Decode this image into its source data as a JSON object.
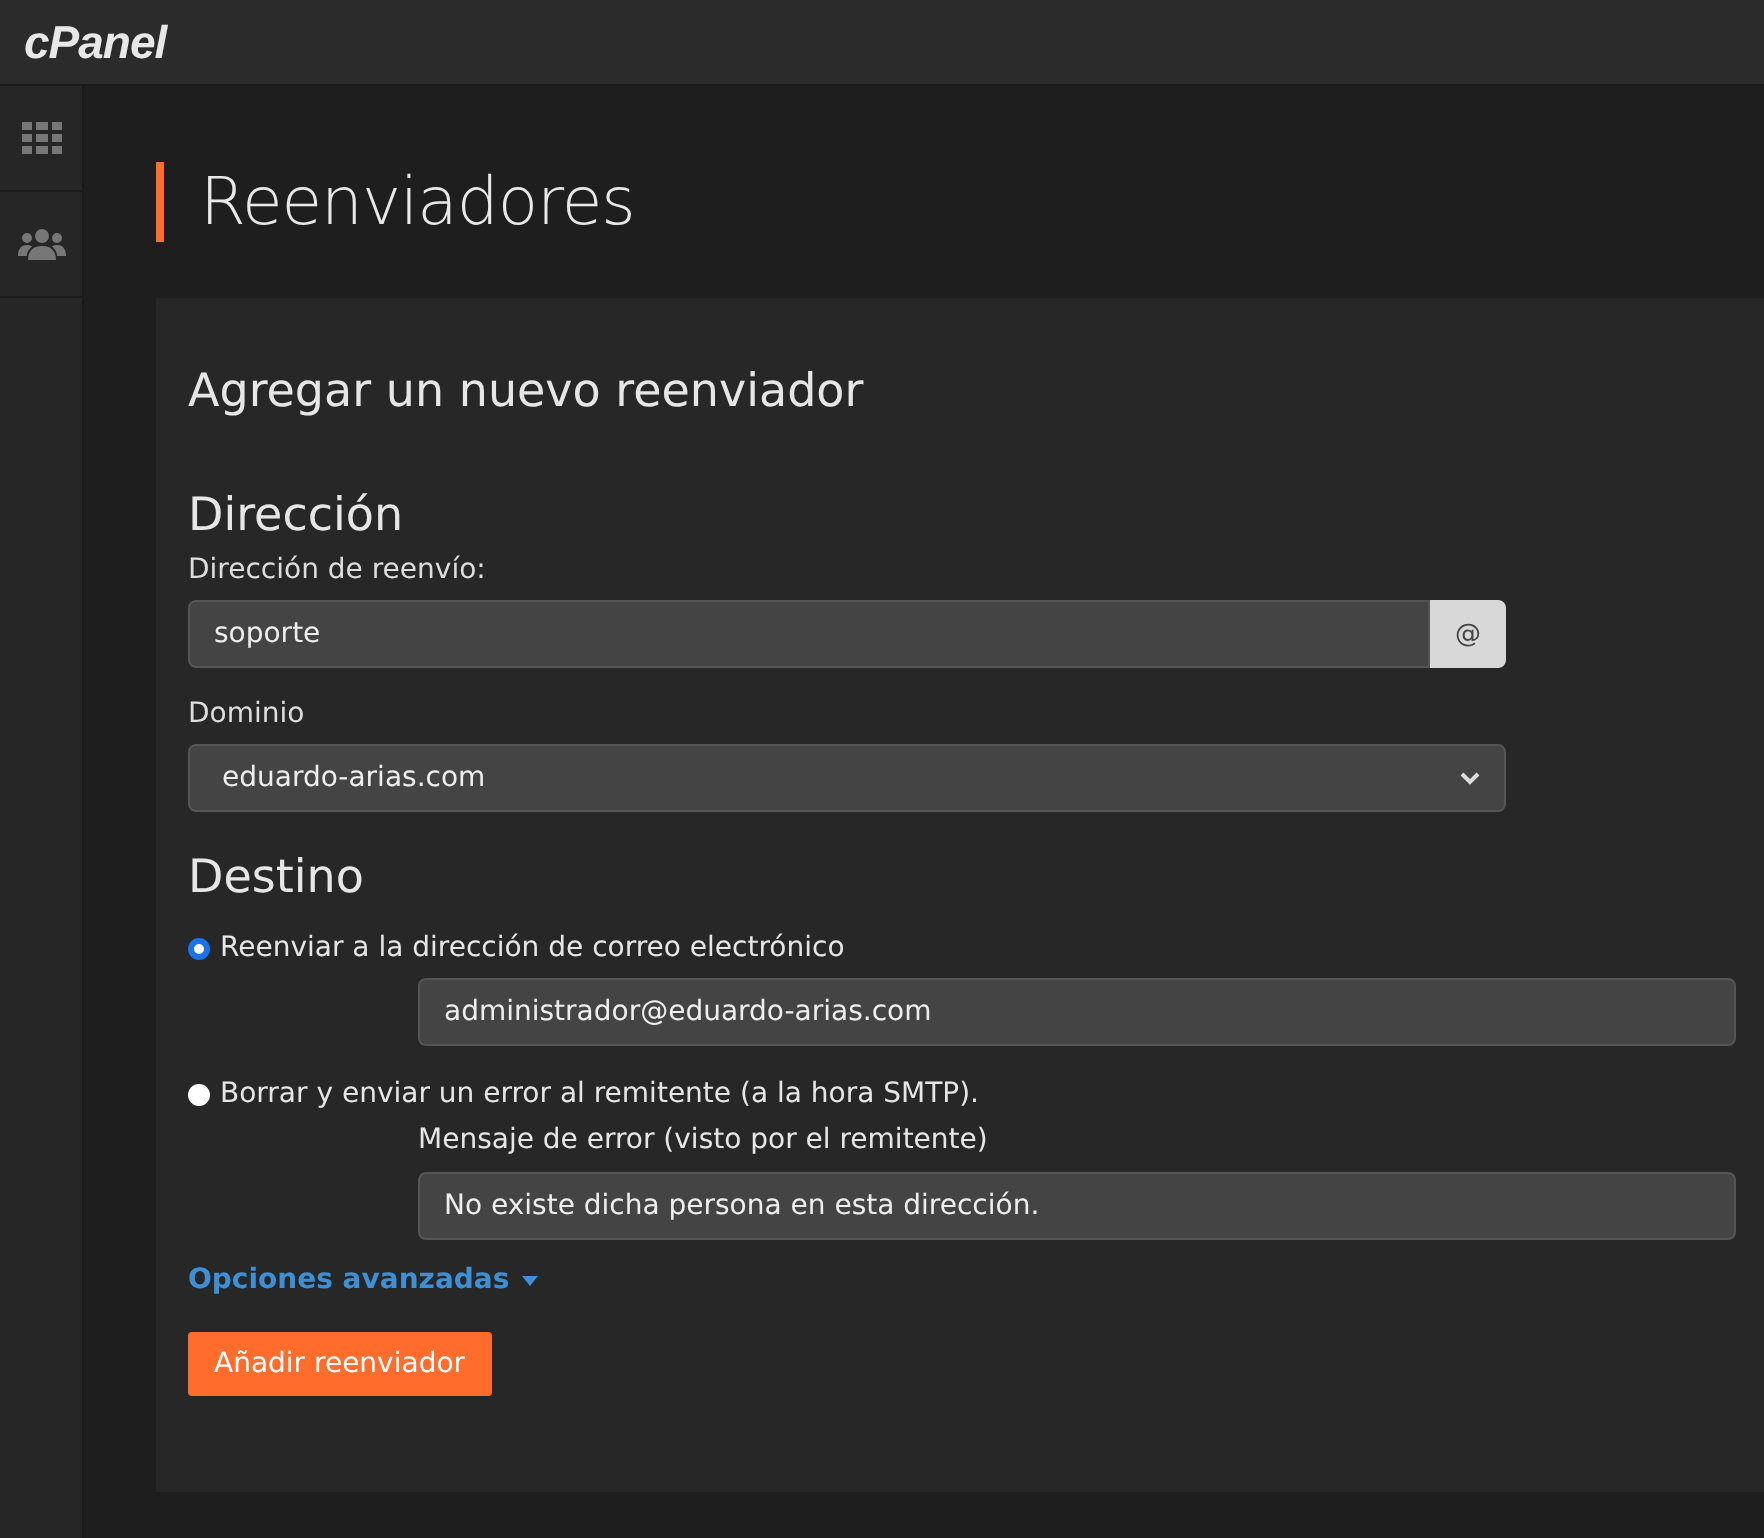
{
  "header": {
    "logo": "cPanel"
  },
  "page": {
    "title": "Reenviadores"
  },
  "panel": {
    "title": "Agregar un nuevo reenviador",
    "address_section": {
      "heading": "Dirección",
      "forward_label": "Dirección de reenvío:",
      "forward_value": "soporte",
      "at_addon": "@",
      "domain_label": "Dominio",
      "domain_value": "eduardo-arias.com"
    },
    "destination_section": {
      "heading": "Destino",
      "options": [
        {
          "label": "Reenviar a la dirección de correo electrónico",
          "selected": true,
          "value": "administrador@eduardo-arias.com"
        },
        {
          "label": "Borrar y enviar un error al remitente (a la hora SMTP).",
          "selected": false,
          "field_label": "Mensaje de error (visto por el remitente)",
          "value": "No existe dicha persona en esta dirección."
        }
      ]
    },
    "advanced_link": "Opciones avanzadas",
    "submit_button": "Añadir reenviador"
  }
}
